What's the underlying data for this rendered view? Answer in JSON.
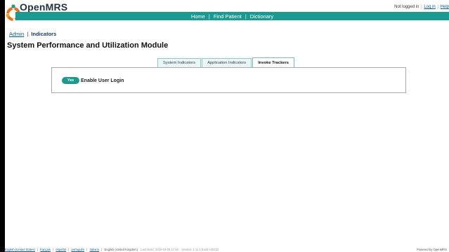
{
  "app": {
    "brand": "OpenMRS"
  },
  "userbar": {
    "status": "Not logged in",
    "login": "Log in",
    "help": "Help"
  },
  "nav": {
    "home": "Home",
    "find_patient": "Find Patient",
    "dictionary": "Dictionary"
  },
  "breadcrumb": {
    "admin": "Admin",
    "current": "Indicators"
  },
  "page": {
    "title": "System Performance and Utilization Module"
  },
  "tabs": [
    {
      "label": "System Indicators"
    },
    {
      "label": "Application Indicators"
    },
    {
      "label": "Invoke Trackers"
    }
  ],
  "tracker": {
    "toggle": "Yes",
    "label": "Enable User Login"
  },
  "footer": {
    "locales": [
      "English (United States)",
      "français",
      "español",
      "português",
      "Italiano"
    ],
    "current_locale": "English (United Kingdom)",
    "build": "Last Build: 2015-03-25 17:46",
    "version": "Version: 1.11.1 Build e29232",
    "powered": "Powered by OpenMRS"
  },
  "colors": {
    "accent": "#1a9a90",
    "link": "#0a5a94"
  }
}
